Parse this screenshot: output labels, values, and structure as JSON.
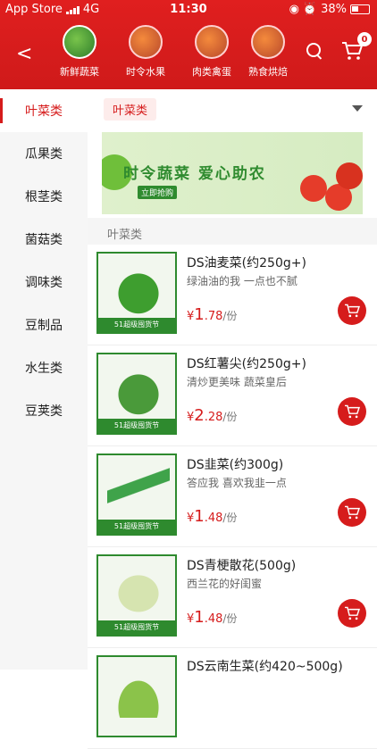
{
  "status_bar": {
    "carrier": "App Store",
    "network": "4G",
    "time": "11:30",
    "battery": "38%"
  },
  "header": {
    "categories": [
      {
        "label": "新鲜蔬菜",
        "active": true
      },
      {
        "label": "时令水果",
        "active": false
      },
      {
        "label": "肉类禽蛋",
        "active": false
      },
      {
        "label": "熟食烘焙",
        "active": false
      }
    ],
    "cart_count": "0"
  },
  "sidebar": {
    "items": [
      {
        "label": "叶菜类",
        "active": true
      },
      {
        "label": "瓜果类"
      },
      {
        "label": "根茎类"
      },
      {
        "label": "菌菇类"
      },
      {
        "label": "调味类"
      },
      {
        "label": "豆制品"
      },
      {
        "label": "水生类"
      },
      {
        "label": "豆荚类"
      }
    ]
  },
  "main": {
    "chip": "叶菜类",
    "banner": {
      "title": "时令蔬菜  爱心助农",
      "button": "立即抢购"
    },
    "section_title": "叶菜类",
    "products": [
      {
        "name": "DS油麦菜(约250g+)",
        "desc": "绿油油的我 一点也不腻",
        "currency": "¥",
        "price_int": "1",
        "price_dec": ".78",
        "unit": "/份",
        "image_tag": "51超级囤货节"
      },
      {
        "name": "DS红薯尖(约250g+)",
        "desc": "清炒更美味 蔬菜皇后",
        "currency": "¥",
        "price_int": "2",
        "price_dec": ".28",
        "unit": "/份",
        "image_tag": "51超级囤货节"
      },
      {
        "name": "DS韭菜(约300g)",
        "desc": "答应我 喜欢我韭一点",
        "currency": "¥",
        "price_int": "1",
        "price_dec": ".48",
        "unit": "/份",
        "image_tag": "51超级囤货节"
      },
      {
        "name": "DS青梗散花(500g)",
        "desc": "西兰花的好闺蜜",
        "currency": "¥",
        "price_int": "1",
        "price_dec": ".48",
        "unit": "/份",
        "image_tag": "51超级囤货节"
      },
      {
        "name": "DS云南生菜(约420~500g)",
        "desc": "",
        "currency": "",
        "price_int": "",
        "price_dec": "",
        "unit": "",
        "image_tag": ""
      }
    ]
  }
}
